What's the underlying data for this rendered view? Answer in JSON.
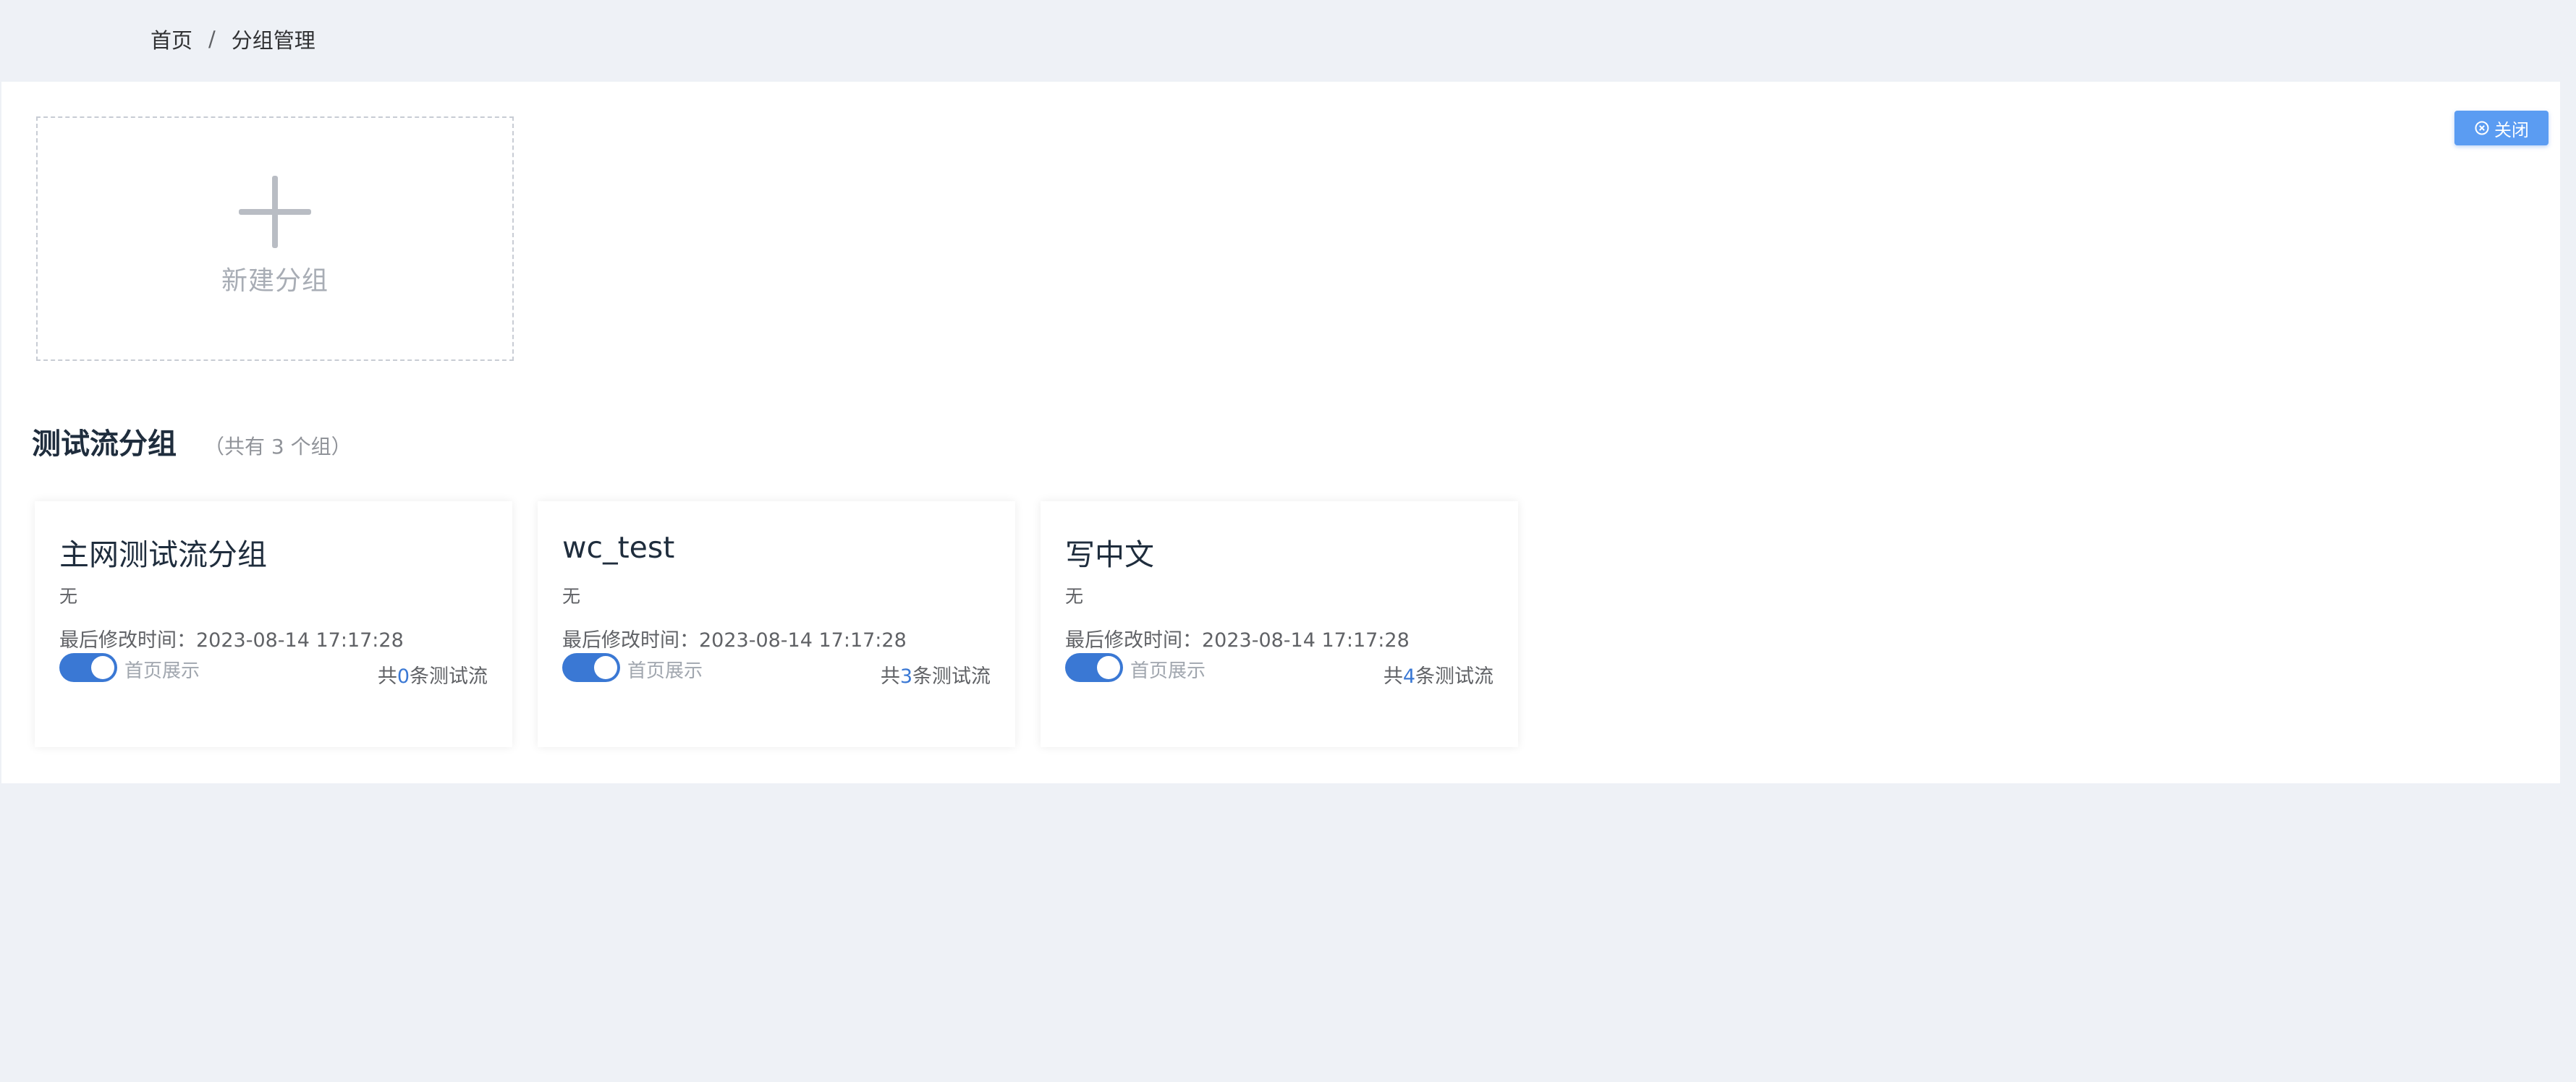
{
  "breadcrumb": {
    "home": "首页",
    "separator": "/",
    "current": "分组管理"
  },
  "close_button": {
    "icon": "close-circle-icon",
    "label": "关闭"
  },
  "new_group": {
    "icon": "plus-icon",
    "label": "新建分组"
  },
  "section": {
    "title": "测试流分组",
    "count_text": "（共有 3 个组）"
  },
  "colors": {
    "accent": "#3a78d4",
    "close_button": "#5b9cf2",
    "background": "#eef1f6"
  },
  "groups": [
    {
      "name": "主网测试流分组",
      "desc": "无",
      "time": "最后修改时间：2023-08-14 17:17:28",
      "toggle_on": true,
      "toggle_label": "首页展示",
      "count_prefix": "共",
      "count": "0",
      "count_suffix": "条测试流"
    },
    {
      "name": "wc_test",
      "desc": "无",
      "time": "最后修改时间：2023-08-14 17:17:28",
      "toggle_on": true,
      "toggle_label": "首页展示",
      "count_prefix": "共",
      "count": "3",
      "count_suffix": "条测试流"
    },
    {
      "name": "写中文",
      "desc": "无",
      "time": "最后修改时间：2023-08-14 17:17:28",
      "toggle_on": true,
      "toggle_label": "首页展示",
      "count_prefix": "共",
      "count": "4",
      "count_suffix": "条测试流"
    }
  ]
}
